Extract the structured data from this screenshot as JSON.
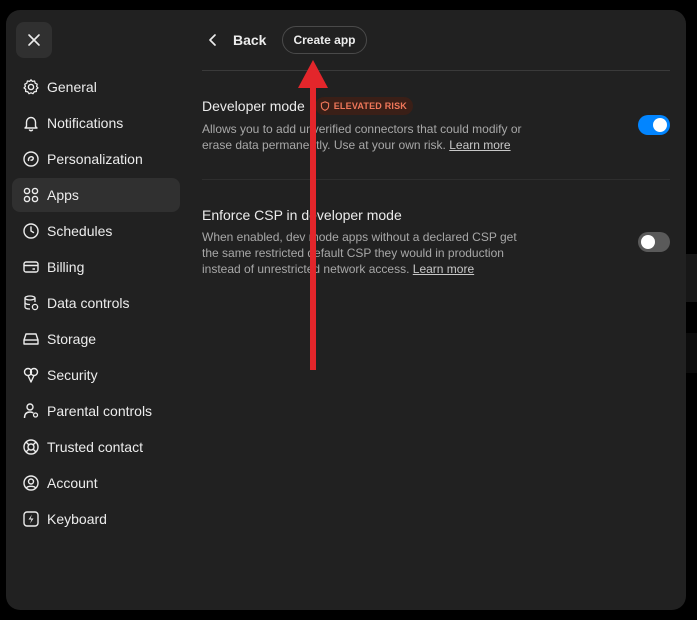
{
  "close_label": "Close",
  "sidebar": {
    "items": [
      {
        "label": "General",
        "icon": "gear-icon"
      },
      {
        "label": "Notifications",
        "icon": "bell-icon"
      },
      {
        "label": "Personalization",
        "icon": "personalization-icon"
      },
      {
        "label": "Apps",
        "icon": "apps-grid-icon",
        "active": true
      },
      {
        "label": "Schedules",
        "icon": "clock-icon"
      },
      {
        "label": "Billing",
        "icon": "card-icon"
      },
      {
        "label": "Data controls",
        "icon": "database-gear-icon"
      },
      {
        "label": "Storage",
        "icon": "storage-icon"
      },
      {
        "label": "Security",
        "icon": "key-icon"
      },
      {
        "label": "Parental controls",
        "icon": "parent-icon"
      },
      {
        "label": "Trusted contact",
        "icon": "lifebuoy-icon"
      },
      {
        "label": "Account",
        "icon": "user-circle-icon"
      },
      {
        "label": "Keyboard",
        "icon": "lightning-icon"
      }
    ]
  },
  "header": {
    "back_label": "Back",
    "create_app_label": "Create app"
  },
  "settings": {
    "developer_mode": {
      "title": "Developer mode",
      "badge": "ELEVATED RISK",
      "description": "Allows you to add unverified connectors that could modify or erase data permanently. Use at your own risk.",
      "link": "Learn more",
      "enabled": true
    },
    "enforce_csp": {
      "title": "Enforce CSP in developer mode",
      "description": "When enabled, dev mode apps without a declared CSP get the same restricted default CSP they would in production instead of unrestricted network access.",
      "link": "Learn more",
      "enabled": false
    }
  },
  "colors": {
    "accent": "#0285ff",
    "badge_text": "#f0775a",
    "annotation_arrow": "#e3262b"
  }
}
